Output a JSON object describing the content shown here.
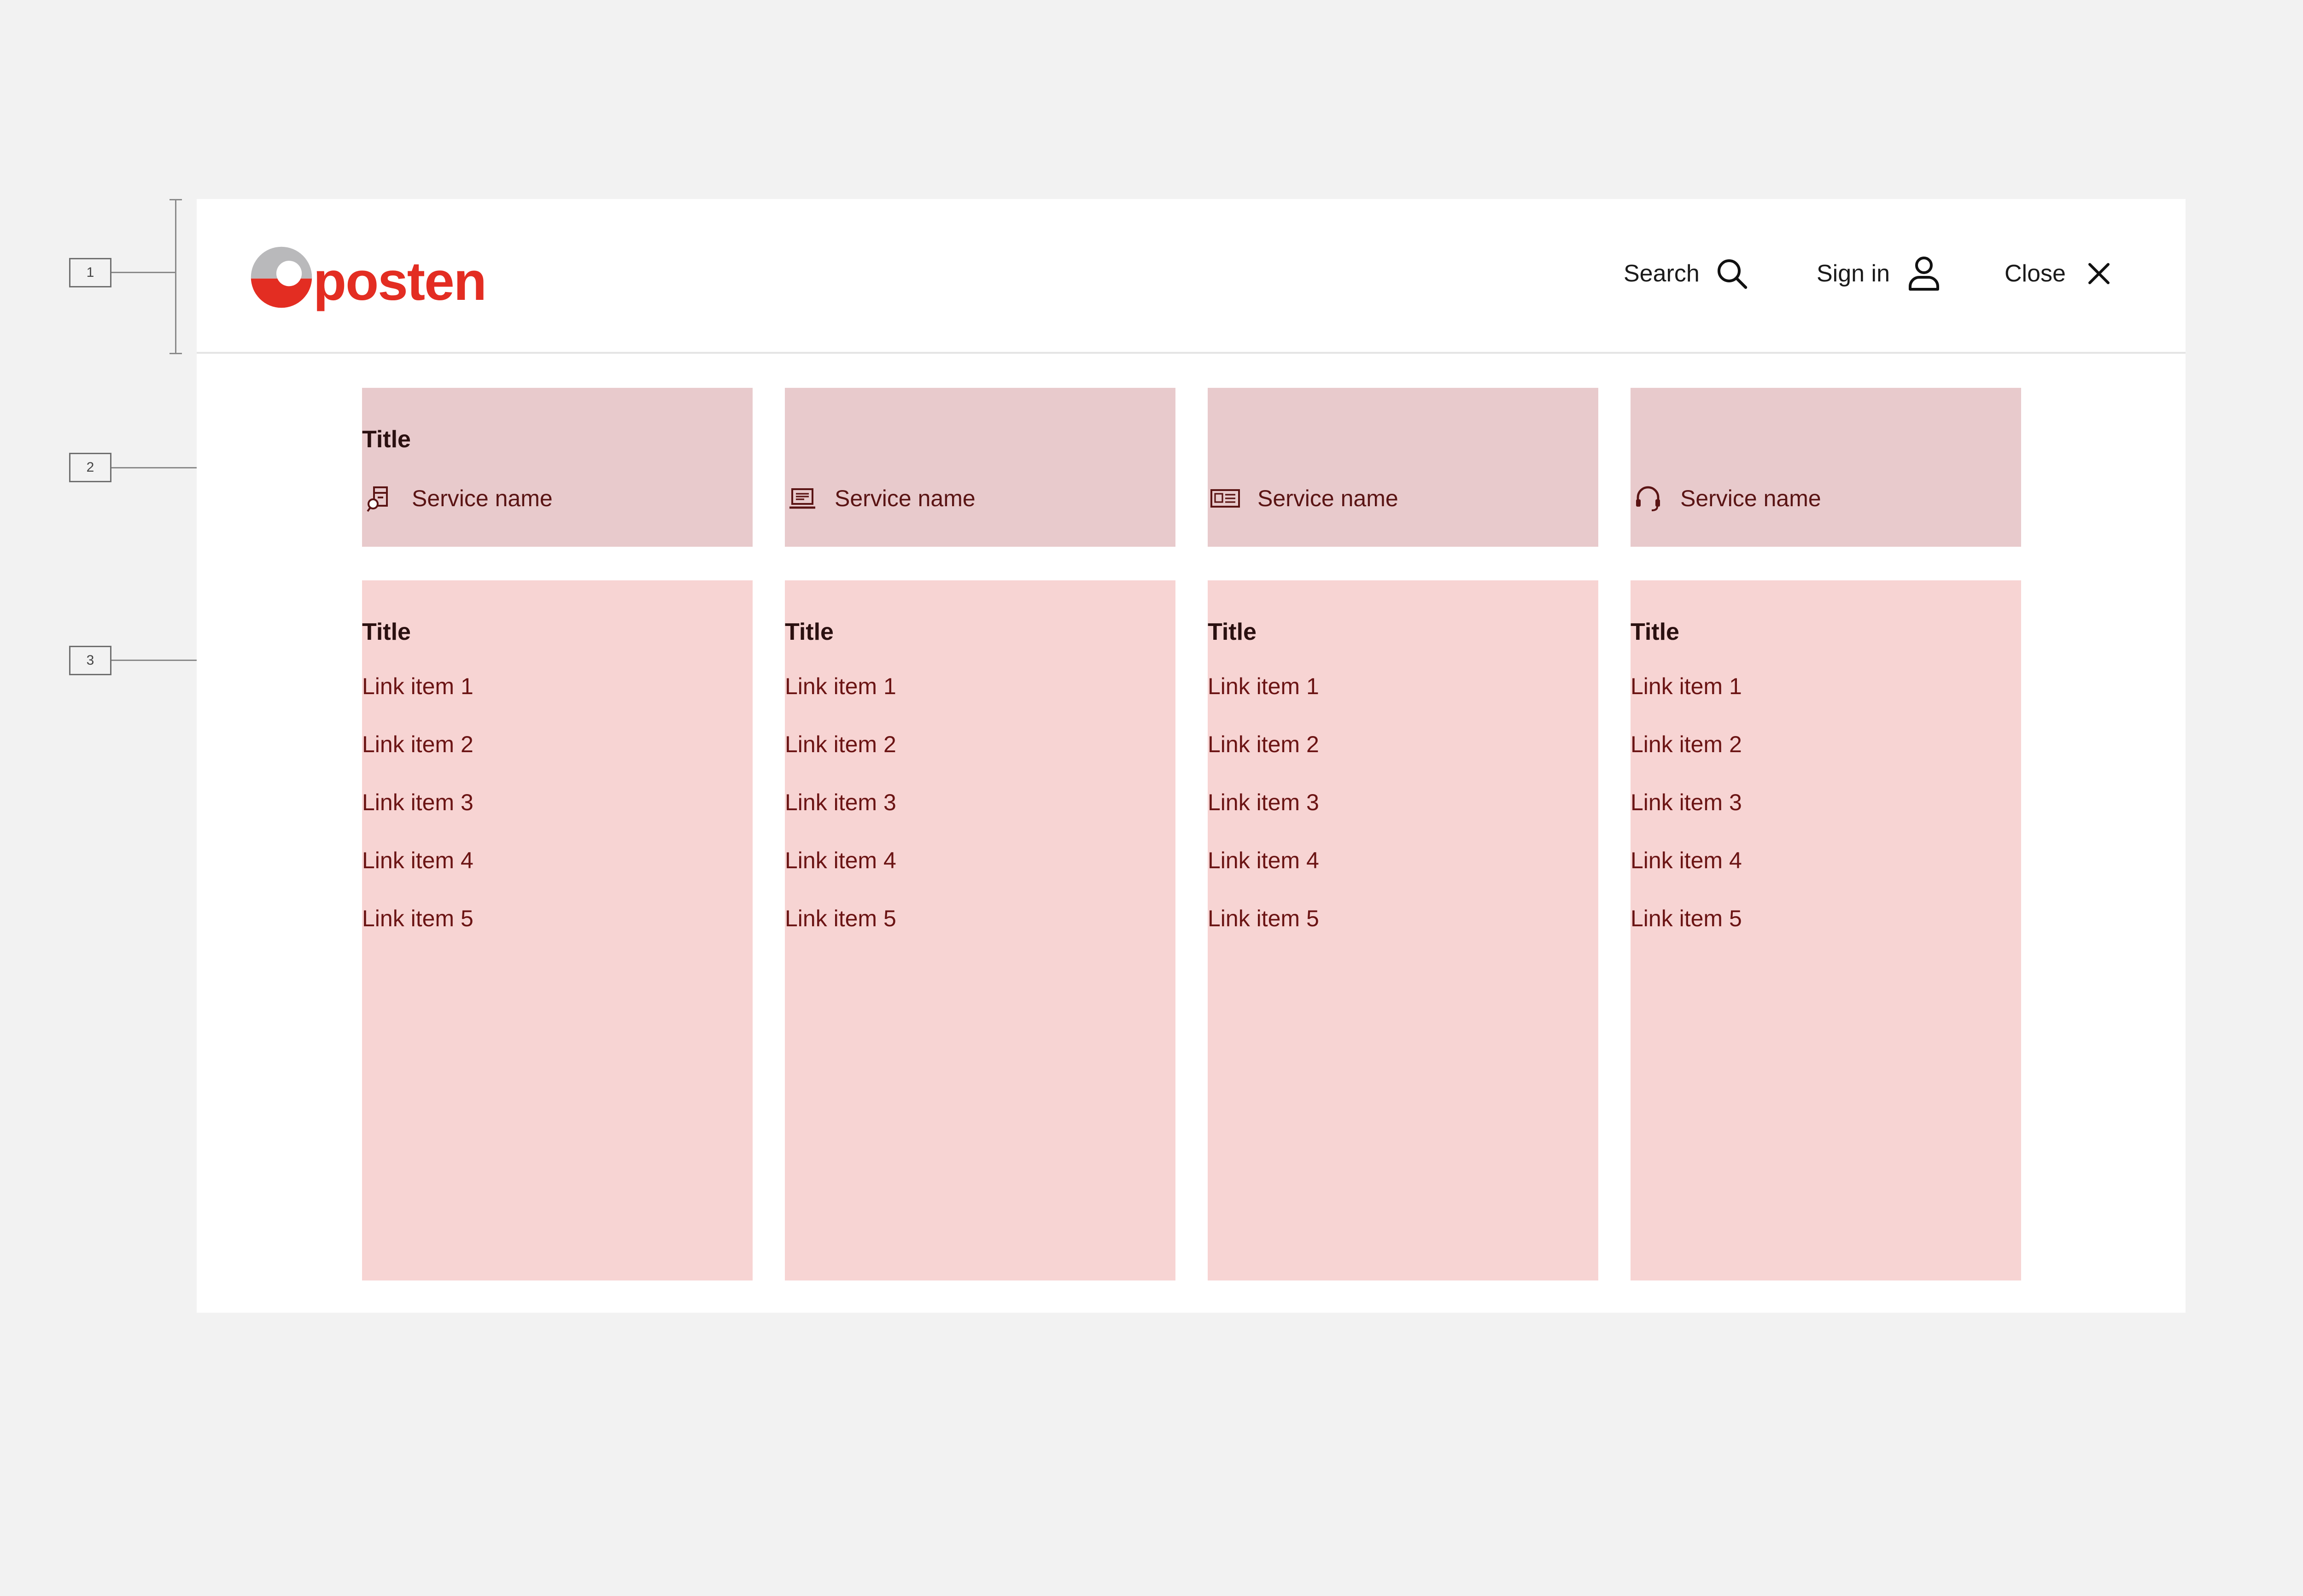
{
  "header": {
    "logo_text": "posten",
    "brand_color": "#e32d22",
    "actions": [
      {
        "label": "Search",
        "icon": "search-icon"
      },
      {
        "label": "Sign in",
        "icon": "user-icon"
      },
      {
        "label": "Close",
        "icon": "close-icon"
      }
    ]
  },
  "service_boxes": [
    {
      "title": "Title",
      "service_name": "Service name",
      "icon": "parcel-pickup-icon"
    },
    {
      "service_name": "Service name",
      "icon": "laptop-icon"
    },
    {
      "service_name": "Service name",
      "icon": "newspaper-icon"
    },
    {
      "service_name": "Service name",
      "icon": "headset-icon"
    }
  ],
  "link_columns": [
    {
      "title": "Title",
      "links": [
        "Link item 1",
        "Link item 2",
        "Link item 3",
        "Link item 4",
        "Link item 5"
      ]
    },
    {
      "title": "Title",
      "links": [
        "Link item 1",
        "Link item 2",
        "Link item 3",
        "Link item 4",
        "Link item 5"
      ]
    },
    {
      "title": "Title",
      "links": [
        "Link item 1",
        "Link item 2",
        "Link item 3",
        "Link item 4",
        "Link item 5"
      ]
    },
    {
      "title": "Title",
      "links": [
        "Link item 1",
        "Link item 2",
        "Link item 3",
        "Link item 4",
        "Link item 5"
      ]
    }
  ],
  "annotations": [
    "1",
    "2",
    "3"
  ],
  "colors": {
    "background": "#f2f2f2",
    "service_box": "#e8cacc",
    "link_box": "#f7d4d3",
    "text_dark_red": "#5a1414"
  }
}
